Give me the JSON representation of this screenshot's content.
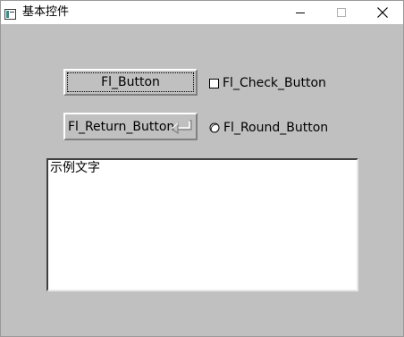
{
  "window": {
    "title": "基本控件",
    "icons": [
      "app-icon",
      "minimize-icon",
      "maximize-icon",
      "close-icon"
    ]
  },
  "controls": {
    "button": {
      "label": "Fl_Button"
    },
    "return_button": {
      "label": "Fl_Return_Button",
      "icon": "return-arrow-icon"
    },
    "check_button": {
      "label": "Fl_Check_Button",
      "checked": false
    },
    "round_button": {
      "label": "Fl_Round_Button",
      "selected": false
    }
  },
  "text_area": {
    "value": "示例文字"
  }
}
